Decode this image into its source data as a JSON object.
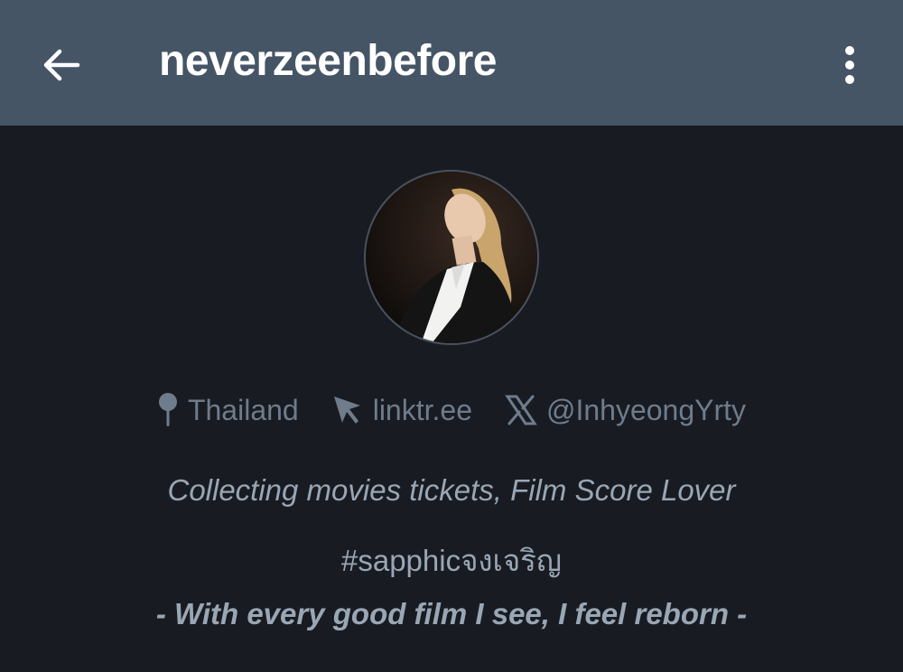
{
  "header": {
    "title": "neverzeenbefore",
    "back_icon": "arrow-left-icon",
    "more_icon": "vertical-dots-icon",
    "background": "#455566"
  },
  "profile": {
    "avatar_alt": "profile-photo",
    "location_icon": "map-pin-icon",
    "location": "Thailand",
    "link_icon": "cursor-arrow-icon",
    "link": "linktr.ee",
    "x_icon": "x-logo-icon",
    "x_handle": "@InhyeongYrty",
    "bio_line1": "Collecting movies tickets, Film Score Lover",
    "bio_line2_tag": "#sapphic",
    "bio_line2_rest": "จงเจริญ",
    "bio_line3": "- With every good film I see, I feel reborn -"
  },
  "colors": {
    "page_bg": "#181c22",
    "meta_text": "#6f7c8c",
    "bio_text": "#9aa6b4"
  }
}
